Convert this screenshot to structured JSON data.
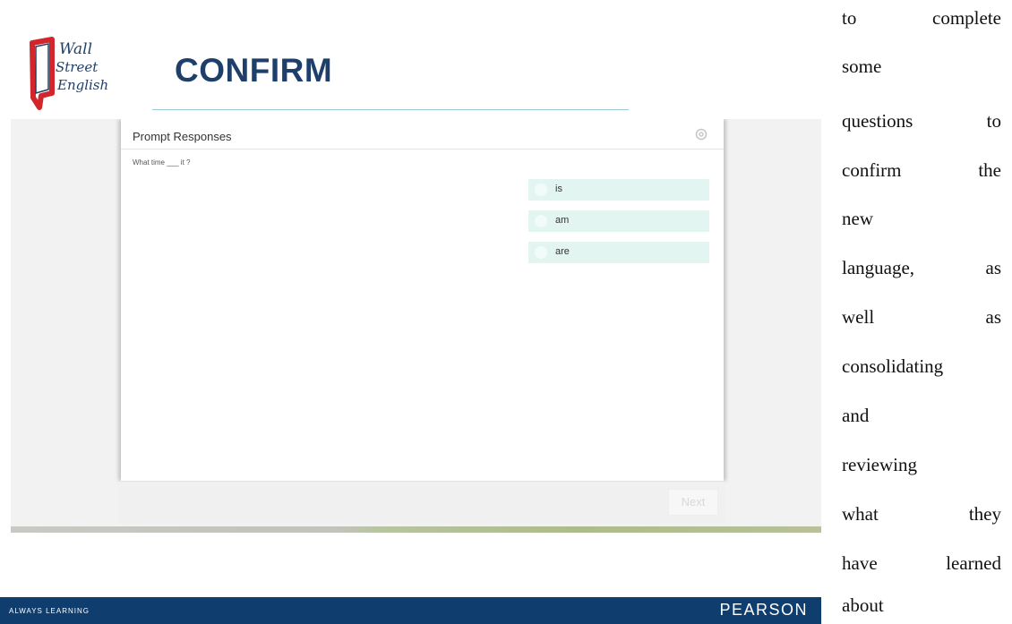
{
  "slide": {
    "title": "CONFIRM",
    "logo": {
      "name": "wall-street-english-logo",
      "text": "Wall Street English"
    }
  },
  "app": {
    "panel_title": "Prompt Responses",
    "settings_icon": "gear-icon",
    "question": "What time ___ it ?",
    "options": [
      {
        "label": "is"
      },
      {
        "label": "am"
      },
      {
        "label": "are"
      }
    ],
    "next_label": "Next"
  },
  "footer": {
    "tagline": "ALWAYS LEARNING",
    "brand": "PEARSON"
  },
  "side_text": {
    "lines": [
      "to complete",
      "some",
      "questions to",
      "confirm the",
      "new",
      "language, as",
      "well as",
      "consolidating",
      "and",
      "reviewing",
      "what they",
      "have learned",
      "about"
    ]
  },
  "colors": {
    "title": "#1f3f6b",
    "footer_bg": "#0e3d6e",
    "option_bg": "#e3f5f1",
    "logo_red": "#d3262b"
  }
}
